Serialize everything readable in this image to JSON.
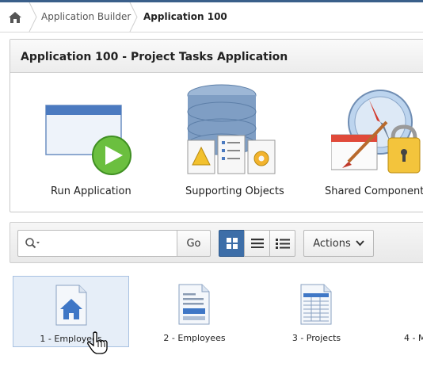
{
  "breadcrumb": {
    "home_icon": "home-icon",
    "items": [
      {
        "label": "Application Builder"
      },
      {
        "label": "Application 100"
      }
    ]
  },
  "app": {
    "title": "Application 100 - Project Tasks Application",
    "actions": [
      {
        "label": "Run Application",
        "icon": "run-application-icon"
      },
      {
        "label": "Supporting Objects",
        "icon": "supporting-objects-icon"
      },
      {
        "label": "Shared Components",
        "icon": "shared-components-icon"
      }
    ]
  },
  "toolbar": {
    "search_value": "",
    "search_placeholder": "",
    "go_label": "Go",
    "view_modes": [
      "icons-view",
      "report-view",
      "details-view"
    ],
    "active_view": "icons-view",
    "actions_label": "Actions"
  },
  "pages": [
    {
      "label": "1 - Employees",
      "icon": "home-page-icon"
    },
    {
      "label": "2 - Employees",
      "icon": "form-page-icon"
    },
    {
      "label": "3 - Projects",
      "icon": "report-page-icon"
    },
    {
      "label": "4 - M",
      "icon": "page-icon"
    }
  ],
  "colors": {
    "accent": "#3d6ea8",
    "selected_bg": "#e6eef8"
  }
}
